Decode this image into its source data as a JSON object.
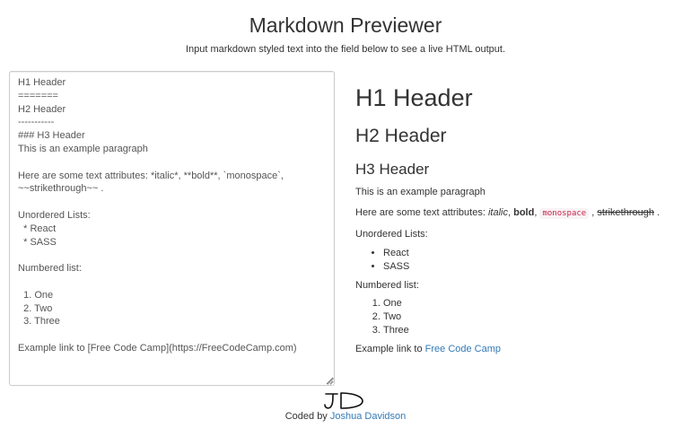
{
  "header": {
    "title": "Markdown Previewer",
    "subtitle": "Input markdown styled text into the field below to see a live HTML output."
  },
  "editor": {
    "value": "H1 Header\n=======\nH2 Header\n-----------\n### H3 Header\nThis is an example paragraph\n\nHere are some text attributes: *italic*, **bold**, `monospace`,\n~~strikethrough~~ .\n\nUnordered Lists:\n  * React\n  * SASS\n\nNumbered list:\n\n  1. One\n  2. Two\n  3. Three\n\nExample link to [Free Code Camp](https://FreeCodeCamp.com)"
  },
  "preview": {
    "h1": "H1 Header",
    "h2": "H2 Header",
    "h3": "H3 Header",
    "paragraph": "This is an example paragraph",
    "attrs_prefix": "Here are some text attributes: ",
    "italic": "italic",
    "sep1": ", ",
    "bold": "bold",
    "sep2": ", ",
    "monospace": "monospace",
    "sep3": " , ",
    "strikethrough": "strikethrough",
    "attrs_suffix": " .",
    "unordered_label": "Unordered Lists:",
    "unordered_items": [
      "React",
      "SASS"
    ],
    "numbered_label": "Numbered list:",
    "numbered_items": [
      "One",
      "Two",
      "Three"
    ],
    "link_prefix": "Example link to ",
    "link_text": "Free Code Camp"
  },
  "footer": {
    "signature_text": "JD",
    "credit_prefix": "Coded by ",
    "credit_link": "Joshua Davidson"
  },
  "colors": {
    "link": "#337ab7",
    "code_text": "#c7254e",
    "code_bg": "#f9f2f4",
    "border": "#cccccc"
  }
}
